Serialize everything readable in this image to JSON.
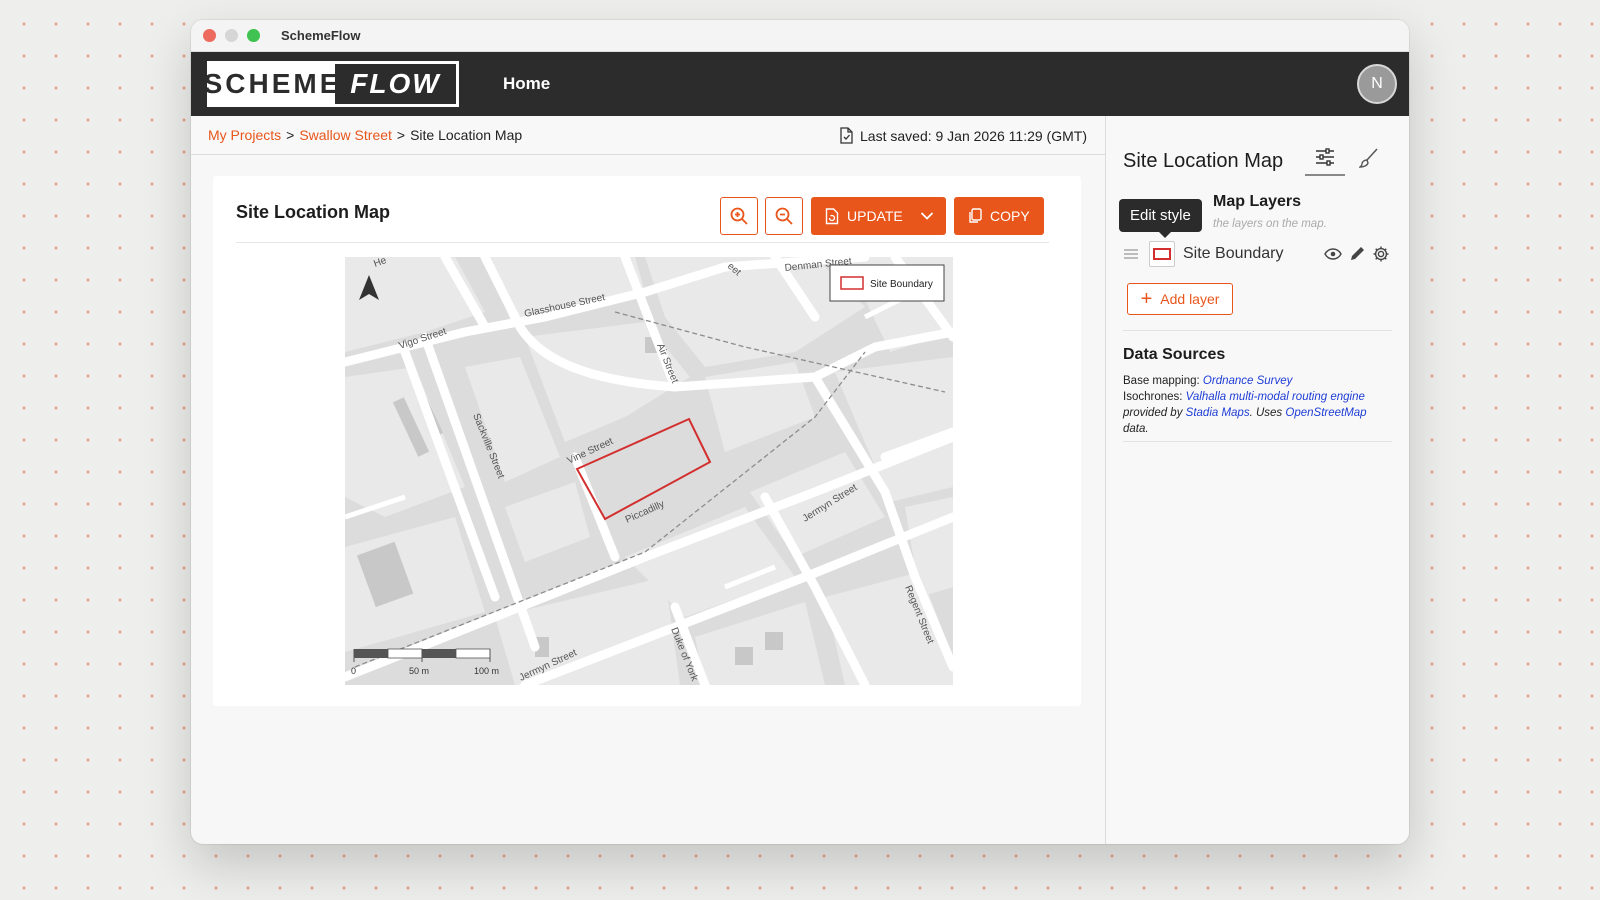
{
  "window": {
    "title": "SchemeFlow"
  },
  "nav": {
    "logo_left": "SCHEME",
    "logo_right": "FLOW",
    "home": "Home",
    "avatar_initial": "N"
  },
  "breadcrumb": {
    "items": [
      "My Projects",
      "Swallow Street",
      "Site Location Map"
    ],
    "separator": ">"
  },
  "last_saved": "Last saved: 9 Jan 2026 11:29 (GMT)",
  "card": {
    "title": "Site Location Map",
    "update_label": "UPDATE",
    "copy_label": "COPY"
  },
  "map": {
    "legend_label": "Site Boundary",
    "streets": {
      "denman": "Denman Street",
      "glasshouse": "Glasshouse Street",
      "vigo": "Vigo Street",
      "air": "Air Street",
      "sackville": "Sackville Street",
      "vine": "Vine Street",
      "piccadilly": "Piccadilly",
      "jermyn1": "Jermyn Street",
      "jermyn2": "Jermyn Street",
      "duke": "Duke of York",
      "regent": "Regent Street",
      "he": "He",
      "eet": "eet"
    },
    "scale": {
      "zero": "0",
      "fifty": "50 m",
      "hundred": "100 m"
    },
    "boundary_color": "#d32f2f"
  },
  "sidebar": {
    "title": "Site Location Map",
    "layers_title": "Map Layers",
    "layers_hint": "the layers on the map.",
    "tooltip": "Edit style",
    "layer_name": "Site Boundary",
    "add_layer": "Add layer",
    "data_sources_title": "Data Sources",
    "ds": {
      "base_prefix": "Base mapping: ",
      "base_link": "Ordnance Survey",
      "iso_prefix": "Isochrones: ",
      "iso_link": "Valhalla multi-modal routing engine",
      "provided_by": " provided by ",
      "stadia_link": "Stadia Maps",
      "uses": ". Uses ",
      "osm_link": "OpenStreetMap",
      "data_suffix": " data."
    }
  },
  "colors": {
    "accent": "#e8561c",
    "nav_bg": "#2c2c2c",
    "link": "#1f3dd6"
  }
}
